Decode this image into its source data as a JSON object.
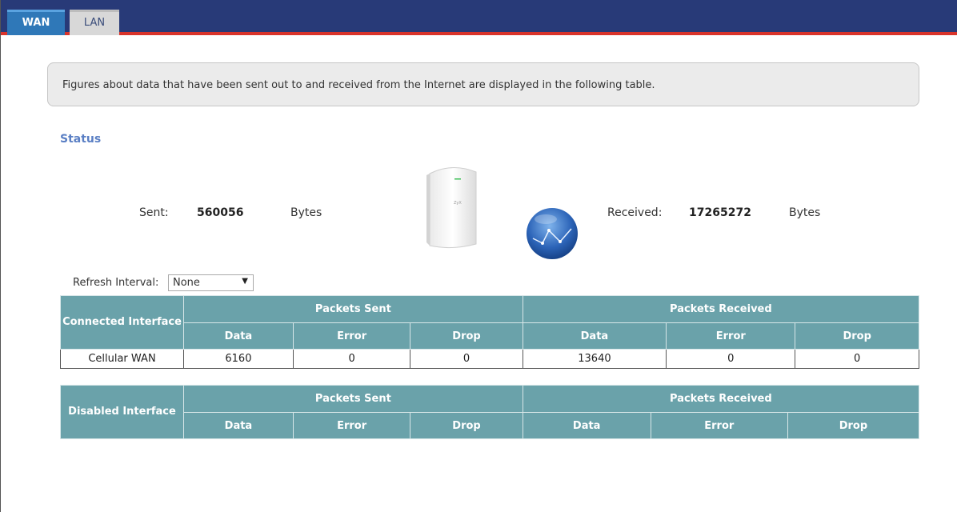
{
  "tabs": [
    {
      "label": "WAN",
      "active": true
    },
    {
      "label": "LAN",
      "active": false
    }
  ],
  "info_text": "Figures about data that have been sent out to and received from the Internet are displayed in the following table.",
  "status": {
    "title": "Status",
    "sent_label": "Sent:",
    "sent_value": "560056",
    "sent_unit": "Bytes",
    "received_label": "Received:",
    "received_value": "17265272",
    "received_unit": "Bytes"
  },
  "refresh": {
    "label": "Refresh Interval:",
    "selected": "None"
  },
  "connected_table": {
    "corner_label": "Connected Interface",
    "group_sent": "Packets Sent",
    "group_received": "Packets Received",
    "sub_headers": [
      "Data",
      "Error",
      "Drop",
      "Data",
      "Error",
      "Drop"
    ],
    "rows": [
      {
        "interface": "Cellular WAN",
        "cells": [
          "6160",
          "0",
          "0",
          "13640",
          "0",
          "0"
        ]
      }
    ]
  },
  "disabled_table": {
    "corner_label": "Disabled Interface",
    "group_sent": "Packets Sent",
    "group_received": "Packets Received",
    "sub_headers": [
      "Data",
      "Error",
      "Drop",
      "Data",
      "Error",
      "Drop"
    ]
  },
  "colors": {
    "tabbar": "#283a78",
    "accent_red": "#d9342b",
    "header_teal": "#6aa2aa",
    "status_title": "#5a7fc4"
  },
  "icons": {
    "device": "router-device-icon",
    "globe": "internet-globe-icon",
    "dropdown": "dropdown-arrow-icon"
  }
}
